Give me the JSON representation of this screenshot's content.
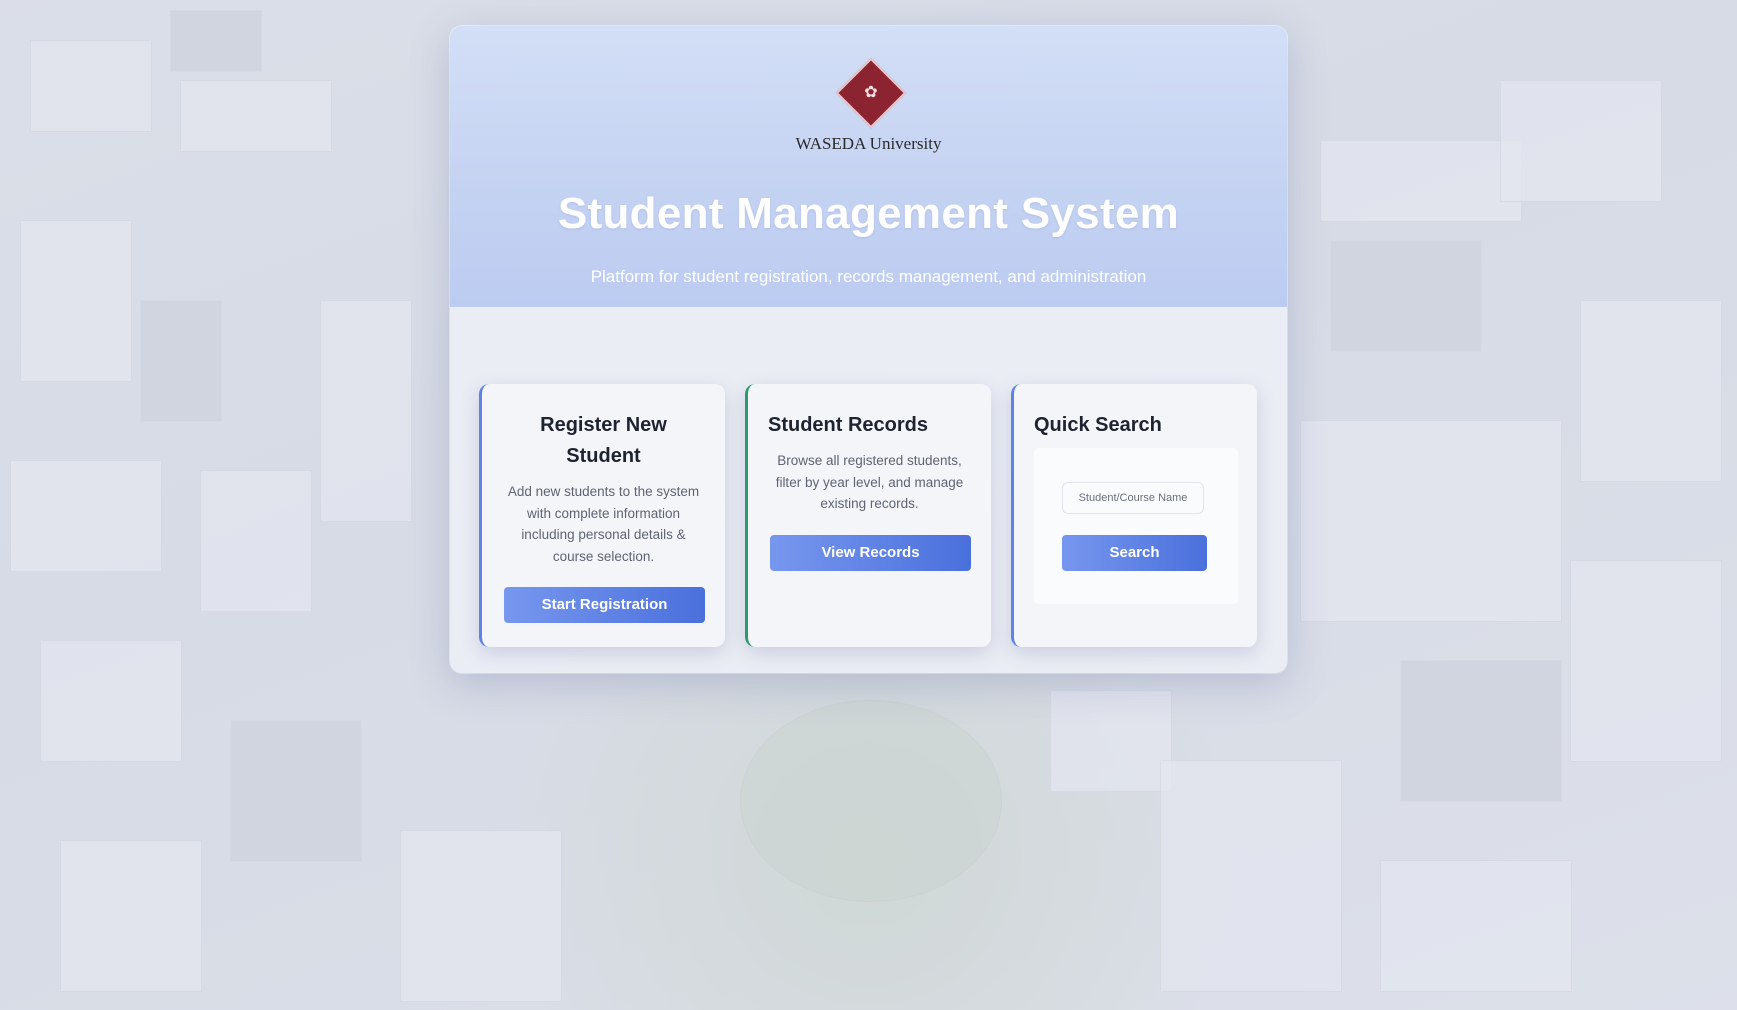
{
  "brand": {
    "logo_text": "WASEDA University",
    "logo_color": "#8b2330"
  },
  "hero": {
    "title": "Student Management System",
    "subtitle": "Platform for student registration, records management, and administration"
  },
  "cards": {
    "register": {
      "title": "Register New Student",
      "description": "Add new students to the system with complete information including personal details & course selection.",
      "button_label": "Start Registration"
    },
    "records": {
      "title": "Student Records",
      "description": "Browse all registered students, filter by year level, and manage existing records.",
      "button_label": "View Records"
    },
    "search": {
      "title": "Quick Search",
      "input_placeholder": "Student/Course Name",
      "input_value": "",
      "button_label": "Search"
    }
  },
  "colors": {
    "accent_blue": "#5d83e6",
    "accent_green": "#2e9a6c",
    "button_gradient_start": "#7797ee",
    "button_gradient_end": "#4a70dc"
  }
}
